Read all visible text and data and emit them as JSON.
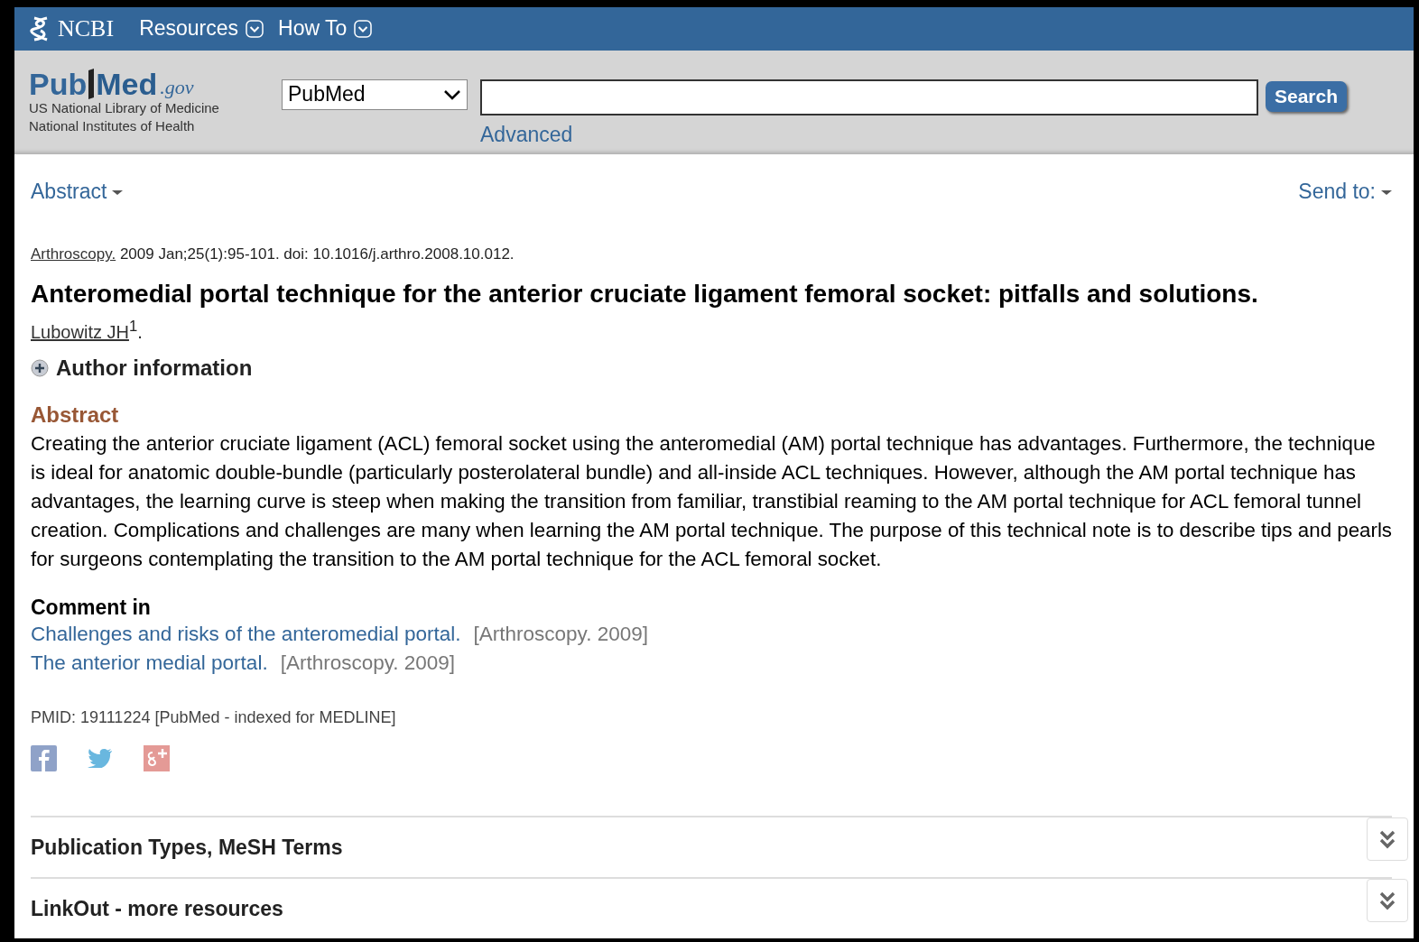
{
  "top_bar": {
    "brand": "NCBI",
    "menus": [
      {
        "label": "Resources"
      },
      {
        "label": "How To"
      }
    ]
  },
  "search_bar": {
    "logo": {
      "first": "Pub",
      "second": "Med",
      "suffix": ".gov",
      "lines": [
        "US National Library of Medicine",
        "National Institutes of Health"
      ]
    },
    "database": "PubMed",
    "button": "Search",
    "advanced": "Advanced"
  },
  "toolbar": {
    "format": "Abstract",
    "send_to": "Send to:"
  },
  "article": {
    "journal": "Arthroscopy.",
    "citation": "2009 Jan;25(1):95-101. doi: 10.1016/j.arthro.2008.10.012.",
    "title": "Anteromedial portal technique for the anterior cruciate ligament femoral socket: pitfalls and solutions.",
    "author": "Lubowitz JH",
    "author_note": "$^{1}$.",
    "author_info": {
      "label": "Author information",
      "expanded": false
    },
    "abstract_heading": "Abstract",
    "abstract": "Creating the anterior cruciate ligament (ACL) femoral socket using the anteromedial (AM) portal technique has advantages. Furthermore, the technique is ideal for anatomic double-bundle (particularly posterolateral bundle) and all-inside ACL techniques. However, although the AM portal technique has advantages, the learning curve is steep when making the transition from familiar, transtibial reaming to the AM portal technique for ACL femoral tunnel creation. Complications and challenges are many when learning the AM portal technique. The purpose of this technical note is to describe tips and pearls for surgeons contemplating the transition to the AM portal technique for the ACL femoral socket.",
    "comment_heading": "Comment in",
    "comments": [
      {
        "title": "Challenges and risks of the anteromedial portal.",
        "source": "[Arthroscopy. 2009]"
      },
      {
        "title": "The anterior medial portal.",
        "source": "[Arthroscopy. 2009]"
      }
    ],
    "pmid": "PMID: 19111224 [PubMed - indexed for MEDLINE]"
  },
  "share": [
    {
      "kind": "facebook"
    },
    {
      "kind": "twitter"
    },
    {
      "kind": "googleplus"
    }
  ],
  "sections": [
    {
      "label": "Publication Types, MeSH Terms",
      "expanded": false
    },
    {
      "label": "LinkOut - more resources",
      "expanded": false
    }
  ]
}
